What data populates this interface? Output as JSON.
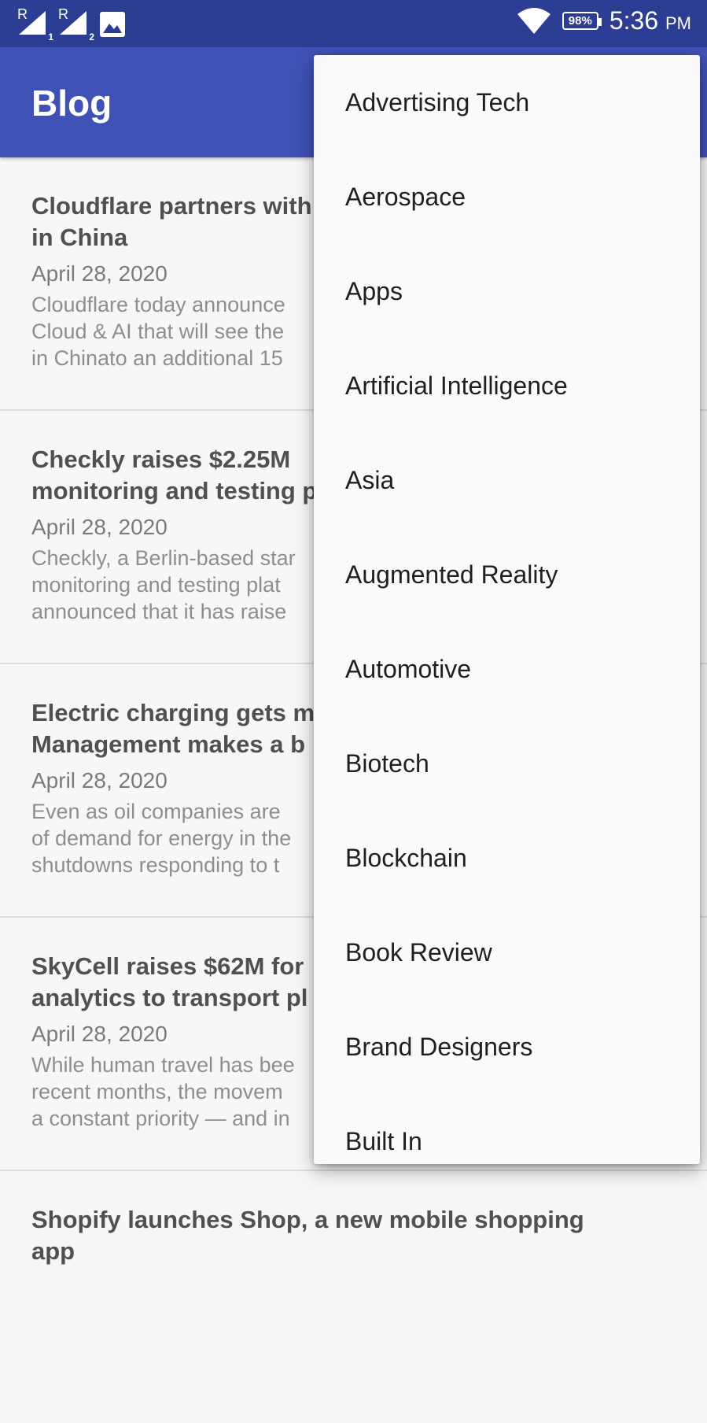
{
  "status_bar": {
    "sim1_label": "R",
    "sim1_index": "1",
    "sim2_label": "R",
    "sim2_index": "2",
    "battery": "98%",
    "time": "5:36",
    "ampm": "PM"
  },
  "app_bar": {
    "title": "Blog"
  },
  "posts": [
    {
      "title_line1": "Cloudflare partners with",
      "title_line2": "in China",
      "date": "April 28, 2020",
      "excerpt_line1": "Cloudflare today announce",
      "excerpt_line2": "Cloud & AI that will see the",
      "excerpt_line3": "in Chinato an additional 15"
    },
    {
      "title_line1": "Checkly raises $2.25M",
      "title_line2": "monitoring and testing p",
      "date": "April 28, 2020",
      "excerpt_line1": "Checkly, a Berlin-based star",
      "excerpt_line2": "monitoring and testing plat",
      "excerpt_line3": "announced that it has raise"
    },
    {
      "title_line1": "Electric charging gets m",
      "title_line2": "Management makes a b",
      "date": "April 28, 2020",
      "excerpt_line1": "Even as oil companies are",
      "excerpt_line2": "of demand for energy in the",
      "excerpt_line3": "shutdowns responding to t"
    },
    {
      "title_line1": "SkyCell raises $62M for",
      "title_line2": "analytics to transport pl",
      "date": "April 28, 2020",
      "excerpt_line1": "While human travel has bee",
      "excerpt_line2": "recent months, the movem",
      "excerpt_line3": "a constant priority — and in"
    },
    {
      "title_line1": "Shopify launches Shop, a new mobile shopping",
      "title_line2": "app",
      "date": "",
      "excerpt_line1": "",
      "excerpt_line2": "",
      "excerpt_line3": ""
    }
  ],
  "menu": {
    "items": [
      "Advertising Tech",
      "Aerospace",
      "Apps",
      "Artificial Intelligence",
      "Asia",
      "Augmented Reality",
      "Automotive",
      "Biotech",
      "Blockchain",
      "Book Review",
      "Brand Designers",
      "Built In"
    ]
  }
}
